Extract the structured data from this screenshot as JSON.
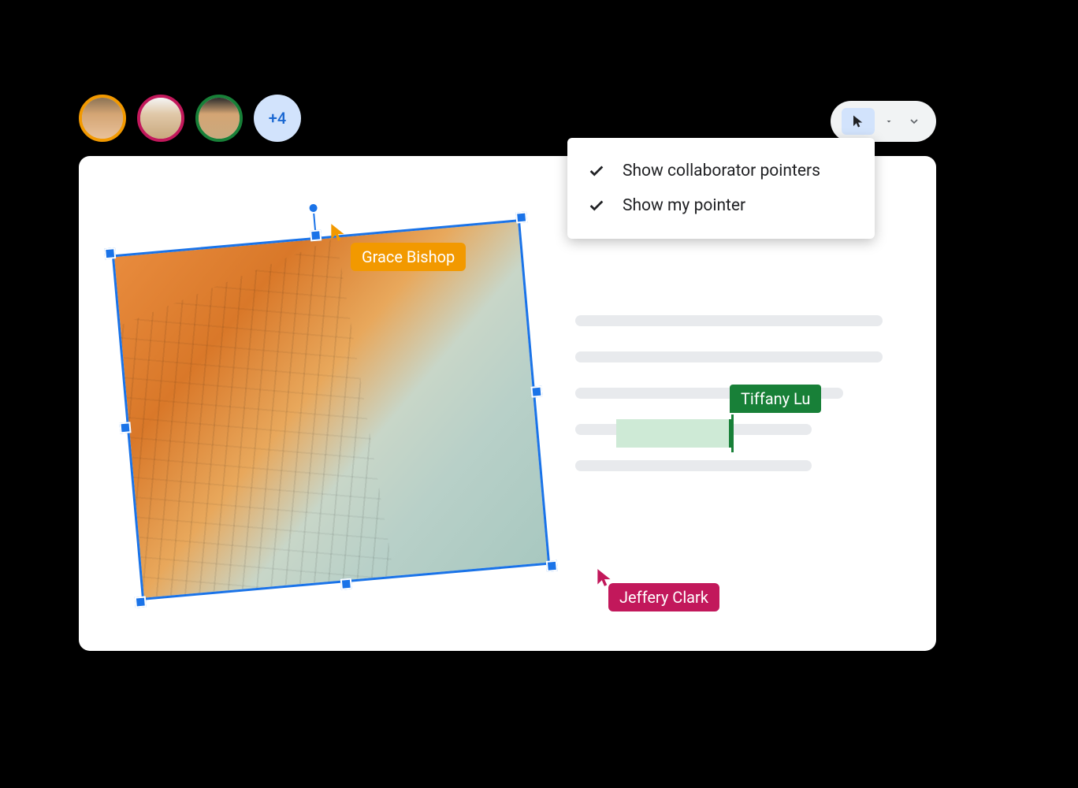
{
  "collaborators": {
    "visible": [
      {
        "name": "Grace Bishop",
        "color": "#F29900"
      },
      {
        "name": "Jeffery Clark",
        "color": "#C2185B"
      },
      {
        "name": "Tiffany Lu",
        "color": "#188038"
      }
    ],
    "overflow_count": "+4"
  },
  "menu": {
    "items": [
      {
        "label": "Show collaborator pointers",
        "checked": true
      },
      {
        "label": "Show my pointer",
        "checked": true
      }
    ]
  },
  "cursors": {
    "grace": {
      "label": "Grace Bishop",
      "color": "#F29900"
    },
    "jeffery": {
      "label": "Jeffery Clark",
      "color": "#C2185B"
    },
    "tiffany": {
      "label": "Tiffany Lu",
      "color": "#188038"
    }
  }
}
